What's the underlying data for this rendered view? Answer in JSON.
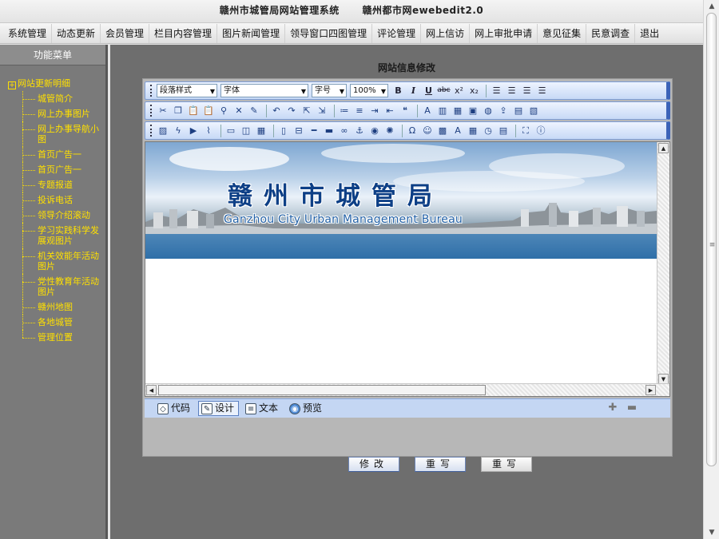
{
  "title_bar": {
    "left": "赣州市城管局网站管理系统",
    "right": "赣州都市网ewebedit2.0"
  },
  "menu": [
    "系统管理",
    "动态更新",
    "会员管理",
    "栏目内容管理",
    "图片新闻管理",
    "领导窗口四图管理",
    "评论管理",
    "网上信访",
    "网上审批申请",
    "意见征集",
    "民意调查",
    "退出"
  ],
  "sidebar": {
    "header": "功能菜单",
    "root": "网站更新明细",
    "items": [
      "城管简介",
      "网上办事图片",
      "网上办事导航小图",
      "首页广告一",
      "首页广告一",
      "专题报道",
      "投诉电话",
      "领导介绍滚动",
      "学习实践科学发展观图片",
      "机关效能年活动图片",
      "党性教育年活动图片",
      "赣州地图",
      "各地城管",
      "管理位置"
    ]
  },
  "form": {
    "title": "网站信息修改"
  },
  "editor": {
    "toolbar": {
      "paragraph_style": "段落样式",
      "font": "字体",
      "font_size": "字号",
      "zoom": "100%"
    },
    "banner": {
      "title_cn": "赣州市城管局",
      "title_en": "Ganzhou City Urban Management Bureau"
    },
    "modes": [
      {
        "label": "代码",
        "icon": "code-icon"
      },
      {
        "label": "设计",
        "icon": "design-icon"
      },
      {
        "label": "文本",
        "icon": "text-icon"
      },
      {
        "label": "预览",
        "icon": "preview-icon"
      }
    ],
    "active_mode": "设计"
  },
  "buttons": {
    "modify": "修改",
    "reset": "重写",
    "rewrite2": "重写"
  }
}
